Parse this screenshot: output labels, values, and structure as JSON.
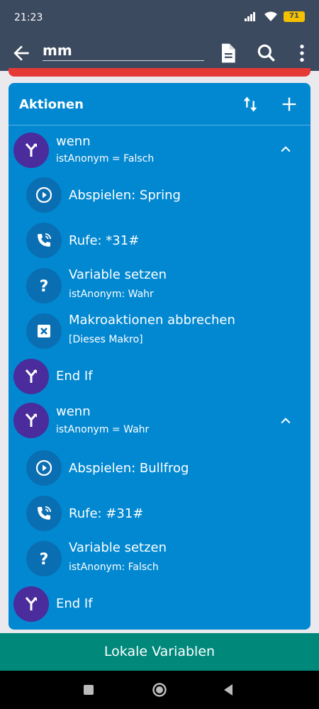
{
  "status": {
    "time": "21:23",
    "battery": "71"
  },
  "appbar": {
    "macro_name": "mm"
  },
  "card": {
    "title": "Aktionen"
  },
  "actions": [
    {
      "title": "wenn",
      "subtitle": "istAnonym = Falsch",
      "icon": "branch-icon"
    },
    {
      "title": "Abspielen: Spring",
      "icon": "play-icon"
    },
    {
      "title": "Rufe: *31#",
      "icon": "phone-call-icon"
    },
    {
      "title": "Variable setzen",
      "subtitle": "istAnonym: Wahr",
      "icon": "question-icon"
    },
    {
      "title": "Makroaktionen abbrechen",
      "subtitle": "[Dieses Makro]",
      "icon": "cancel-box-icon"
    },
    {
      "title": "End If",
      "icon": "branch-icon"
    },
    {
      "title": "wenn",
      "subtitle": "istAnonym = Wahr",
      "icon": "branch-icon"
    },
    {
      "title": "Abspielen: Bullfrog",
      "icon": "play-icon"
    },
    {
      "title": "Rufe: #31#",
      "icon": "phone-call-icon"
    },
    {
      "title": "Variable setzen",
      "subtitle": "istAnonym: Falsch",
      "icon": "question-icon"
    },
    {
      "title": "End If",
      "icon": "branch-icon"
    }
  ],
  "bottom_button": {
    "label": "Lokale Variablen"
  },
  "colors": {
    "appbar": "#3b4a5f",
    "card": "#0288d1",
    "purple": "#4a2c9c",
    "teal": "#00897b",
    "red": "#e53935"
  }
}
